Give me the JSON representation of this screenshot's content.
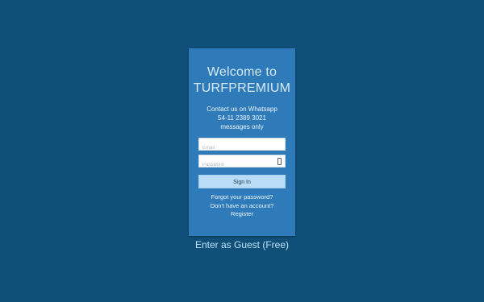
{
  "login_card": {
    "welcome_line1": "Welcome to",
    "welcome_line2": "TURFPREMIUM",
    "contact_line1": "Contact us on Whatsapp",
    "contact_line2": "54-11 2389 3021",
    "contact_line3": "messages only",
    "email_placeholder": "Email",
    "password_placeholder": "Password",
    "sign_in_label": "Sign In",
    "forgot_password": "Forgot your password?",
    "no_account": "Don't have an account?",
    "register": "Register"
  },
  "guest_link": "Enter as Guest (Free)",
  "colors": {
    "background": "#0f4f78",
    "card": "#2f7ab8",
    "button": "#b9ddf6",
    "guest_text": "#bfe3fa"
  },
  "icons": {
    "password_toggle": "eye-icon"
  }
}
